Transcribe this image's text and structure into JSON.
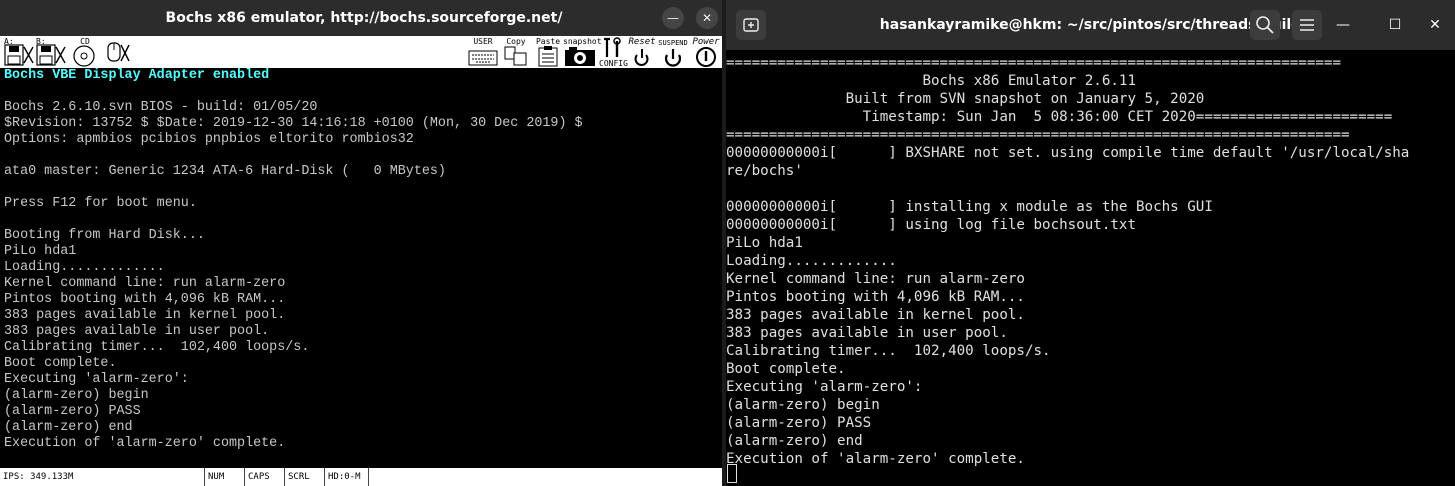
{
  "bochs": {
    "title": "Bochs x86 emulator, http://bochs.sourceforge.net/",
    "min_glyph": "—",
    "close_glyph": "✕",
    "toolbar": {
      "floppy_a": "A:",
      "floppy_b": "B:",
      "cdrom": "CD",
      "user": "USER",
      "copy": "Copy",
      "paste": "Paste",
      "snapshot": "snapshot",
      "config": "CONFIG",
      "reset": "Reset",
      "suspend": "SUSPEND",
      "power": "Power"
    },
    "console_first_line": "Bochs VBE Display Adapter enabled",
    "console_lines": [
      "",
      "Bochs 2.6.10.svn BIOS - build: 01/05/20",
      "$Revision: 13752 $ $Date: 2019-12-30 14:16:18 +0100 (Mon, 30 Dec 2019) $",
      "Options: apmbios pcibios pnpbios eltorito rombios32",
      "",
      "ata0 master: Generic 1234 ATA-6 Hard-Disk (   0 MBytes)",
      "",
      "Press F12 for boot menu.",
      "",
      "Booting from Hard Disk...",
      "PiLo hda1",
      "Loading.............",
      "Kernel command line: run alarm-zero",
      "Pintos booting with 4,096 kB RAM...",
      "383 pages available in kernel pool.",
      "383 pages available in user pool.",
      "Calibrating timer...  102,400 loops/s.",
      "Boot complete.",
      "Executing 'alarm-zero':",
      "(alarm-zero) begin",
      "(alarm-zero) PASS",
      "(alarm-zero) end",
      "Execution of 'alarm-zero' complete."
    ],
    "status": {
      "ips": "IPS: 349.133M",
      "num": "NUM",
      "caps": "CAPS",
      "scrl": "SCRL",
      "hd": "HD:0-M"
    }
  },
  "terminal": {
    "title": "hasankayramike@hkm: ~/src/pintos/src/threads/build",
    "min_glyph": "—",
    "max_glyph": "☐",
    "close_glyph": "✕",
    "console_text": "========================================================================\n                       Bochs x86 Emulator 2.6.11\n              Built from SVN snapshot on January 5, 2020\n                Timestamp: Sun Jan  5 08:36:00 CET 2020=======================\n=========================================================================\n00000000000i[      ] BXSHARE not set. using compile time default '/usr/local/sha\nre/bochs'\n\n00000000000i[      ] installing x module as the Bochs GUI\n00000000000i[      ] using log file bochsout.txt\nPiLo hda1\nLoading.............\nKernel command line: run alarm-zero\nPintos booting with 4,096 kB RAM...\n383 pages available in kernel pool.\n383 pages available in user pool.\nCalibrating timer...  102,400 loops/s.\nBoot complete.\nExecuting 'alarm-zero':\n(alarm-zero) begin\n(alarm-zero) PASS\n(alarm-zero) end\nExecution of 'alarm-zero' complete."
  }
}
